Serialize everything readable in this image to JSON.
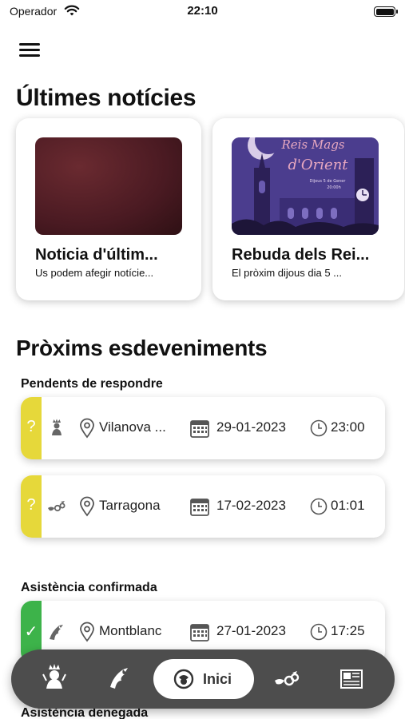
{
  "status_bar": {
    "carrier": "Operador",
    "time": "22:10"
  },
  "header": {
    "menu_icon": "hamburger-menu-icon"
  },
  "news": {
    "title": "Últimes notícies",
    "cards": [
      {
        "title": "Noticia d'últim...",
        "subtitle": "Us podem afegir notície..."
      },
      {
        "title": "Rebuda dels Rei...",
        "subtitle": "El pròxim dijous dia 5 ...",
        "image_text": {
          "line1": "Reis Mags",
          "line2": "d'Orient",
          "line3": "Dijous 5 de Gener",
          "line4": "20:00h"
        }
      }
    ]
  },
  "events": {
    "title": "Pròxims esdeveniments",
    "pending": {
      "title": "Pendents de respondre",
      "items": [
        {
          "status_mark": "?",
          "place": "Vilanova ...",
          "date": "29-01-2023",
          "time": "23:00",
          "role_icon": "giant-figure-icon",
          "color": "#e6d83a"
        },
        {
          "status_mark": "?",
          "place": "Tarragona",
          "date": "17-02-2023",
          "time": "01:01",
          "role_icon": "dragon-figure-icon",
          "color": "#e6d83a"
        }
      ]
    },
    "confirmed": {
      "title": "Asistència confirmada",
      "items": [
        {
          "status_mark": "✓",
          "place": "Montblanc",
          "date": "27-01-2023",
          "time": "17:25",
          "role_icon": "eagle-figure-icon",
          "color": "#3db34a"
        }
      ]
    },
    "denied": {
      "title": "Asistència denegada"
    }
  },
  "tab_bar": {
    "items": [
      {
        "icon": "giant-figure-icon"
      },
      {
        "icon": "eagle-figure-icon"
      },
      {
        "icon": "home-icon",
        "label": "Inici",
        "active": true
      },
      {
        "icon": "dragon-figure-icon"
      },
      {
        "icon": "newspaper-icon"
      }
    ]
  },
  "colors": {
    "pending": "#e6d83a",
    "confirmed": "#3db34a",
    "tab_bar": "#4d4d4d"
  }
}
